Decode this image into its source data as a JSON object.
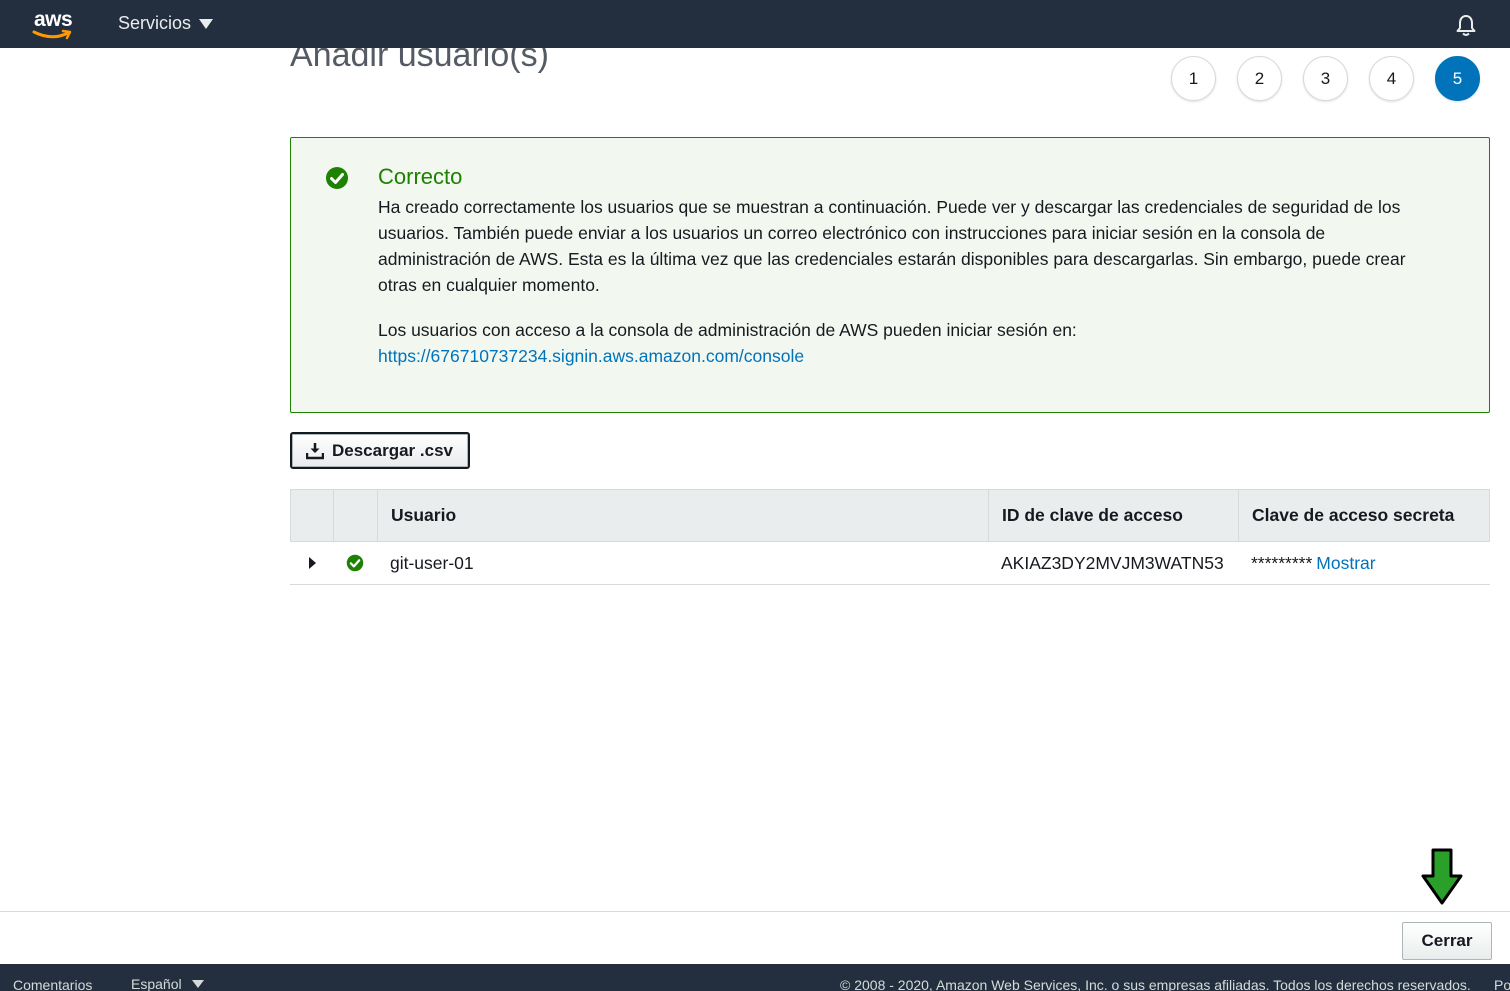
{
  "topnav": {
    "logo_text": "aws",
    "services_label": "Servicios"
  },
  "page": {
    "title": "Añadir usuario(s)"
  },
  "steps": [
    "1",
    "2",
    "3",
    "4",
    "5"
  ],
  "success": {
    "title": "Correcto",
    "message": "Ha creado correctamente los usuarios que se muestran a continuación. Puede ver y descargar las credenciales de seguridad de los usuarios. También puede enviar a los usuarios un correo electrónico con instrucciones para iniciar sesión en la consola de administración de AWS. Esta es la última vez que las credenciales estarán disponibles para descargarlas. Sin embargo, puede crear otras en cualquier momento.",
    "console_text": "Los usuarios con acceso a la consola de administración de AWS pueden iniciar sesión en:",
    "console_url": "https://676710737234.signin.aws.amazon.com/console"
  },
  "download_button": "Descargar .csv",
  "table": {
    "columns": [
      "Usuario",
      "ID de clave de acceso",
      "Clave de acceso secreta"
    ],
    "rows": [
      {
        "user": "git-user-01",
        "access_key_id": "AKIAZ3DY2MVJM3WATN53",
        "secret_masked": "*********",
        "show_label": "Mostrar"
      }
    ]
  },
  "close_button": "Cerrar",
  "footer": {
    "feedback": "Comentarios",
    "language": "Español",
    "copyright": "© 2008 - 2020, Amazon Web Services, Inc. o sus empresas afiliadas. Todos los derechos reservados.",
    "extra": "Po"
  },
  "colors": {
    "nav_bg": "#232f3e",
    "success_green": "#1d8102",
    "link_blue": "#0073bb",
    "step_active": "#0073bb",
    "annotation_arrow": "#2aa02a"
  }
}
